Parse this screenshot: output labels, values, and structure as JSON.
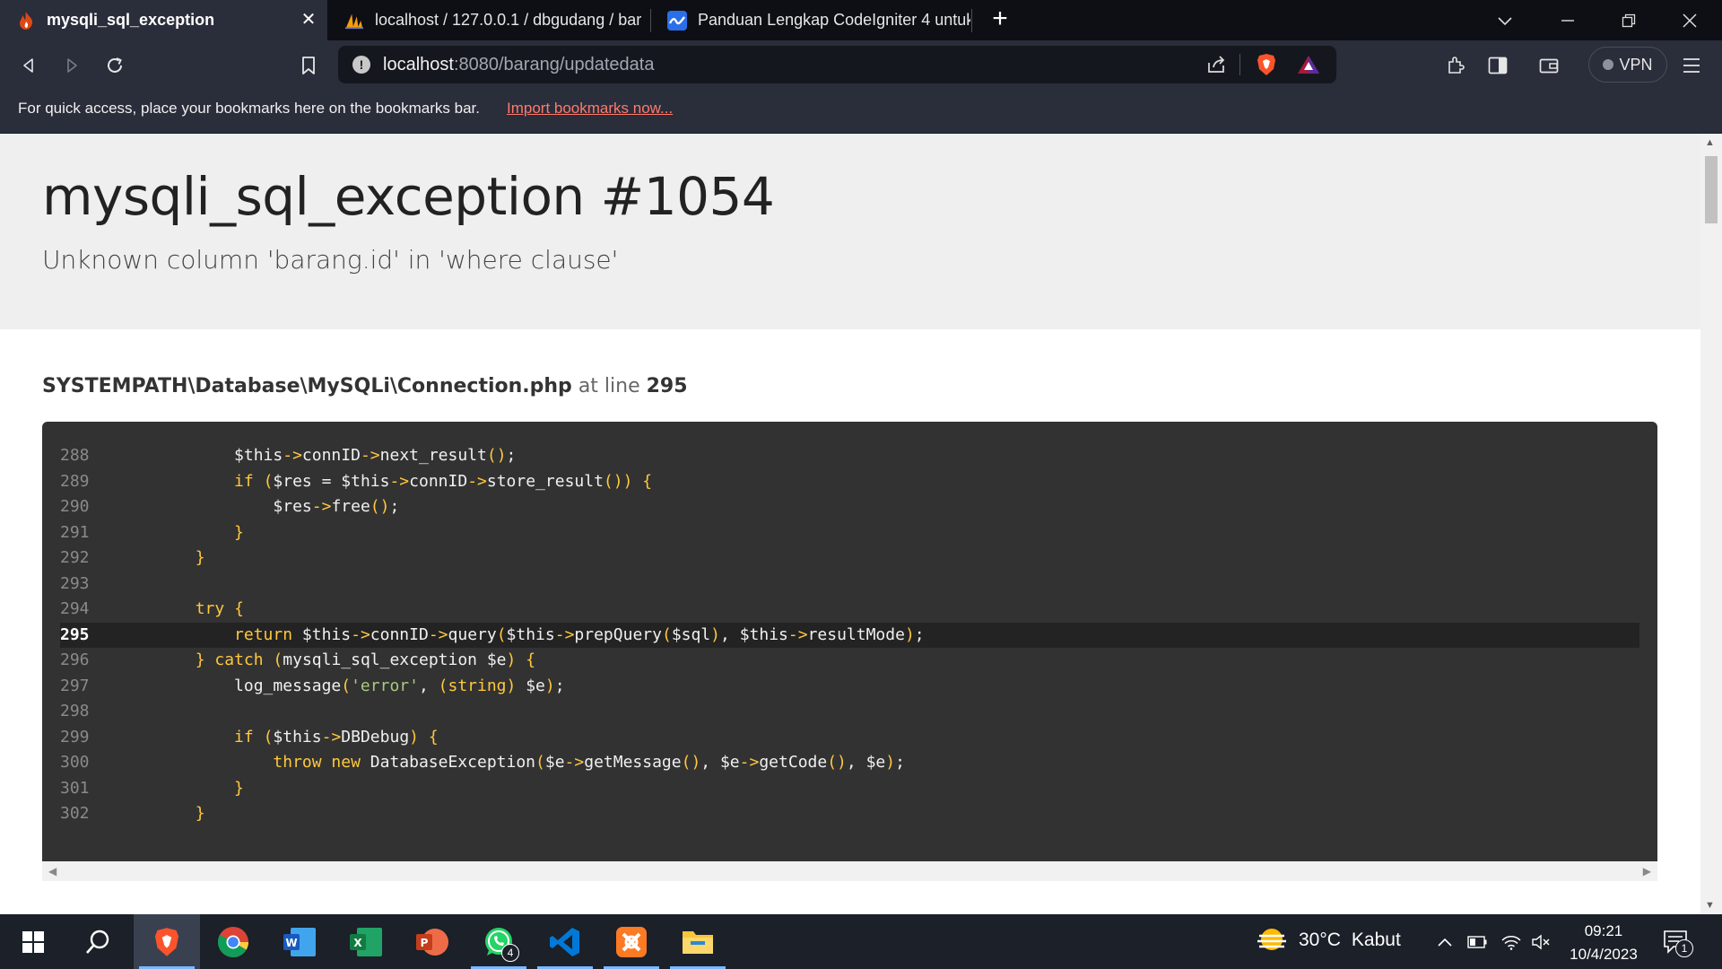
{
  "browser": {
    "tabs": [
      {
        "title": "mysqli_sql_exception",
        "active": true
      },
      {
        "title": "localhost / 127.0.0.1 / dbgudang / bar",
        "active": false
      },
      {
        "title": "Panduan Lengkap CodeIgniter 4 untuk",
        "active": false
      }
    ],
    "url_host": "localhost",
    "url_rest": ":8080/barang/updatedata",
    "vpn_label": "VPN",
    "bookmark_message": "For quick access, place your bookmarks here on the bookmarks bar.",
    "bookmark_link": "Import bookmarks now...",
    "accent": "#fb542b"
  },
  "page": {
    "title": "mysqli_sql_exception #1054",
    "message": "Unknown column 'barang.id' in 'where clause'",
    "file_path": "SYSTEMPATH\\Database\\MySQLi\\Connection.php",
    "at_line_label": "at line",
    "line_number": "295",
    "code": [
      {
        "n": "288",
        "t": "            $this->connID->next_result();"
      },
      {
        "n": "289",
        "t": "            if ($res = $this->connID->store_result()) {"
      },
      {
        "n": "290",
        "t": "                $res->free();"
      },
      {
        "n": "291",
        "t": "            }"
      },
      {
        "n": "292",
        "t": "        }"
      },
      {
        "n": "293",
        "t": ""
      },
      {
        "n": "294",
        "t": "        try {"
      },
      {
        "n": "295",
        "t": "            return $this->connID->query($this->prepQuery($sql), $this->resultMode);",
        "hl": true
      },
      {
        "n": "296",
        "t": "        } catch (mysqli_sql_exception $e) {"
      },
      {
        "n": "297",
        "t": "            log_message('error', (string) $e);"
      },
      {
        "n": "298",
        "t": ""
      },
      {
        "n": "299",
        "t": "            if ($this->DBDebug) {"
      },
      {
        "n": "300",
        "t": "                throw new DatabaseException($e->getMessage(), $e->getCode(), $e);"
      },
      {
        "n": "301",
        "t": "            }"
      },
      {
        "n": "302",
        "t": "        }"
      }
    ]
  },
  "taskbar": {
    "whatsapp_badge": "4",
    "weather_temp": "30°C",
    "weather_text": "Kabut",
    "time": "09:21",
    "date": "10/4/2023",
    "notification_count": "1"
  }
}
